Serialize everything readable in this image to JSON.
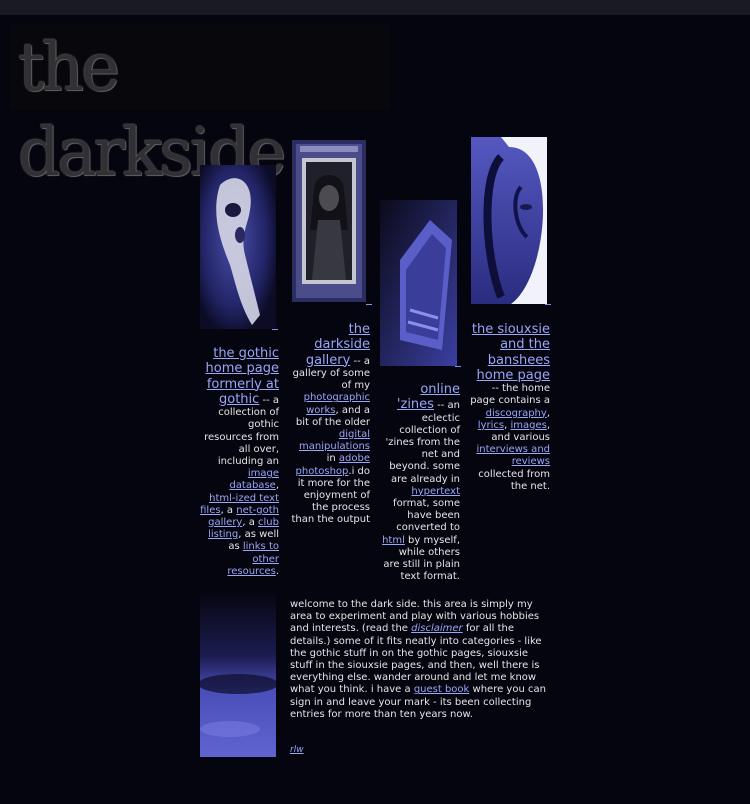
{
  "banner": {
    "text": "the darkside"
  },
  "col1": {
    "title": "the gothic home page formerly at gothic",
    "p1": " -- a collection of gothic resources from all over, including an ",
    "link1": "image database",
    "p2": ", ",
    "link2": "html-ized text files",
    "p3": ", a ",
    "link3": "net-goth gallery",
    "p4": ", a ",
    "link4": "club listing",
    "p5": ", as well as ",
    "link5": "links to other resources",
    "p6": "."
  },
  "col2": {
    "title": "the darkside gallery",
    "p1": " -- a gallery of some of my ",
    "link1": "photographic works",
    "p2": ", and a bit of the older ",
    "link2": "digital manipulations",
    "p3": " in ",
    "link3": "adobe photoshop",
    "p4": ".i do it more for the enjoyment of the process than the output"
  },
  "col3": {
    "title": "online 'zines",
    "p1": " -- an eclectic collection of 'zines from the net and beyond. some are already in ",
    "link1": "hypertext",
    "p2": " format, some have been converted to ",
    "link2": "html",
    "p3": " by myself, while others are still in plain text format."
  },
  "col4": {
    "title": "the siouxsie and the banshees home page",
    "p1": " -- the home page contains a ",
    "link1": "discography",
    "p2": ", ",
    "link2": "lyrics",
    "p3": ", ",
    "link3": "images",
    "p4": ", and various ",
    "link4": "interviews and reviews",
    "p5": " collected from the net."
  },
  "intro": {
    "p1": "welcome to the dark side. this area is simply my area to experiment and play with various hobbies and interests. (read the ",
    "link_disclaimer": "disclaimer",
    "p2": " for all the details.) some of it fits neatly into categories - like the gothic stuff in on the gothic pages, siouxsie stuff in the siouxsie pages, and then, well there is everything else. wander around and let me know what you think. i have a ",
    "link_guestbook": "guest book",
    "p3": " where you can sign in and leave your mark - its been collecting entries for more than ten years now."
  },
  "signature": "rlw",
  "colors": {
    "link": "#9aa6f6",
    "background": "#050510",
    "text": "#e6e6e6"
  }
}
